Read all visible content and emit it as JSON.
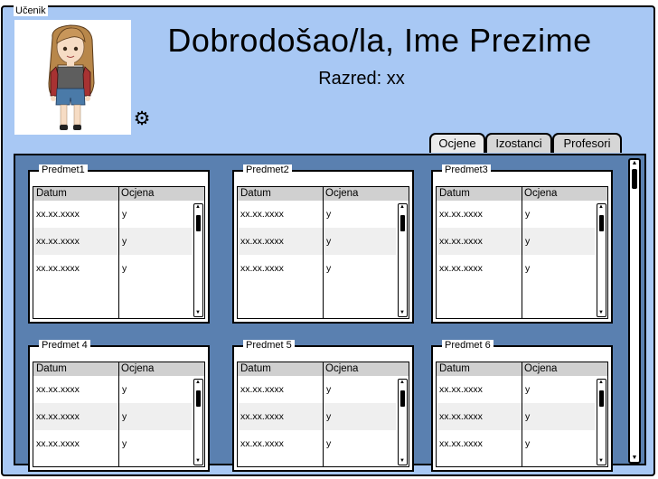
{
  "window": {
    "title": "Učenik"
  },
  "header": {
    "welcome": "Dobrodošao/la, Ime Prezime",
    "class_label": "Razred: xx"
  },
  "icons": {
    "settings": "gear-icon",
    "avatar": "student-avatar"
  },
  "tabs": [
    {
      "label": "Ocjene",
      "active": true
    },
    {
      "label": "Izostanci",
      "active": false
    },
    {
      "label": "Profesori",
      "active": false
    }
  ],
  "columns": {
    "date": "Datum",
    "grade": "Ocjena"
  },
  "subjects": [
    {
      "name": "Predmet1",
      "rows": [
        {
          "date": "xx.xx.xxxx",
          "grade": "y"
        },
        {
          "date": "xx.xx.xxxx",
          "grade": "y"
        },
        {
          "date": "xx.xx.xxxx",
          "grade": "y"
        }
      ]
    },
    {
      "name": "Predmet2",
      "rows": [
        {
          "date": "xx.xx.xxxx",
          "grade": "y"
        },
        {
          "date": "xx.xx.xxxx",
          "grade": "y"
        },
        {
          "date": "xx.xx.xxxx",
          "grade": "y"
        }
      ]
    },
    {
      "name": "Predmet3",
      "rows": [
        {
          "date": "xx.xx.xxxx",
          "grade": "y"
        },
        {
          "date": "xx.xx.xxxx",
          "grade": "y"
        },
        {
          "date": "xx.xx.xxxx",
          "grade": "y"
        }
      ]
    },
    {
      "name": "Predmet 4",
      "rows": [
        {
          "date": "xx.xx.xxxx",
          "grade": "y"
        },
        {
          "date": "xx.xx.xxxx",
          "grade": "y"
        },
        {
          "date": "xx.xx.xxxx",
          "grade": "y"
        }
      ]
    },
    {
      "name": "Predmet 5",
      "rows": [
        {
          "date": "xx.xx.xxxx",
          "grade": "y"
        },
        {
          "date": "xx.xx.xxxx",
          "grade": "y"
        },
        {
          "date": "xx.xx.xxxx",
          "grade": "y"
        }
      ]
    },
    {
      "name": "Predmet 6",
      "rows": [
        {
          "date": "xx.xx.xxxx",
          "grade": "y"
        },
        {
          "date": "xx.xx.xxxx",
          "grade": "y"
        },
        {
          "date": "xx.xx.xxxx",
          "grade": "y"
        }
      ]
    }
  ],
  "colors": {
    "window_bg": "#a8c8f4",
    "panel_bg": "#5a80b0",
    "header_row": "#d0d0d0",
    "alt_row": "#efefef"
  }
}
